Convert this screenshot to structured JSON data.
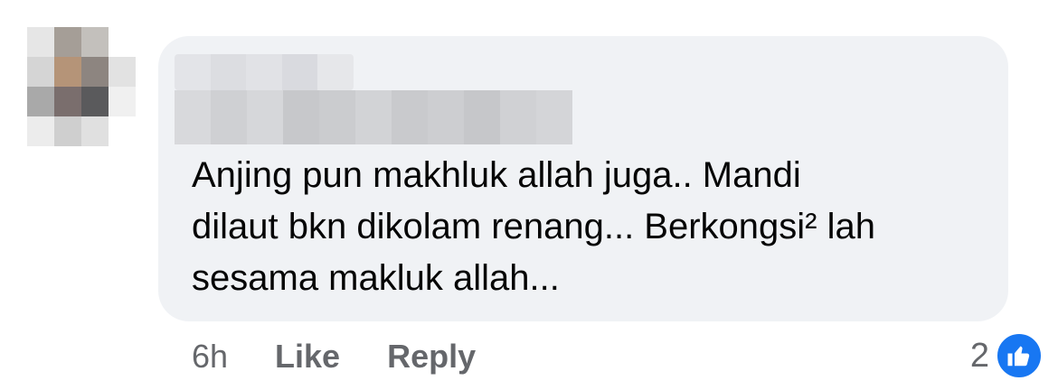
{
  "comment": {
    "author_name_redacted": true,
    "text": "Anjing pun makhluk allah juga.. Mandi\ndilaut bkn dikolam renang... Berkongsi² lah\nsesama makluk allah..."
  },
  "actions": {
    "time": "6h",
    "like_label": "Like",
    "reply_label": "Reply"
  },
  "reactions": {
    "count": "2",
    "icon": "thumbs-up-icon",
    "color": "#1877f2"
  }
}
